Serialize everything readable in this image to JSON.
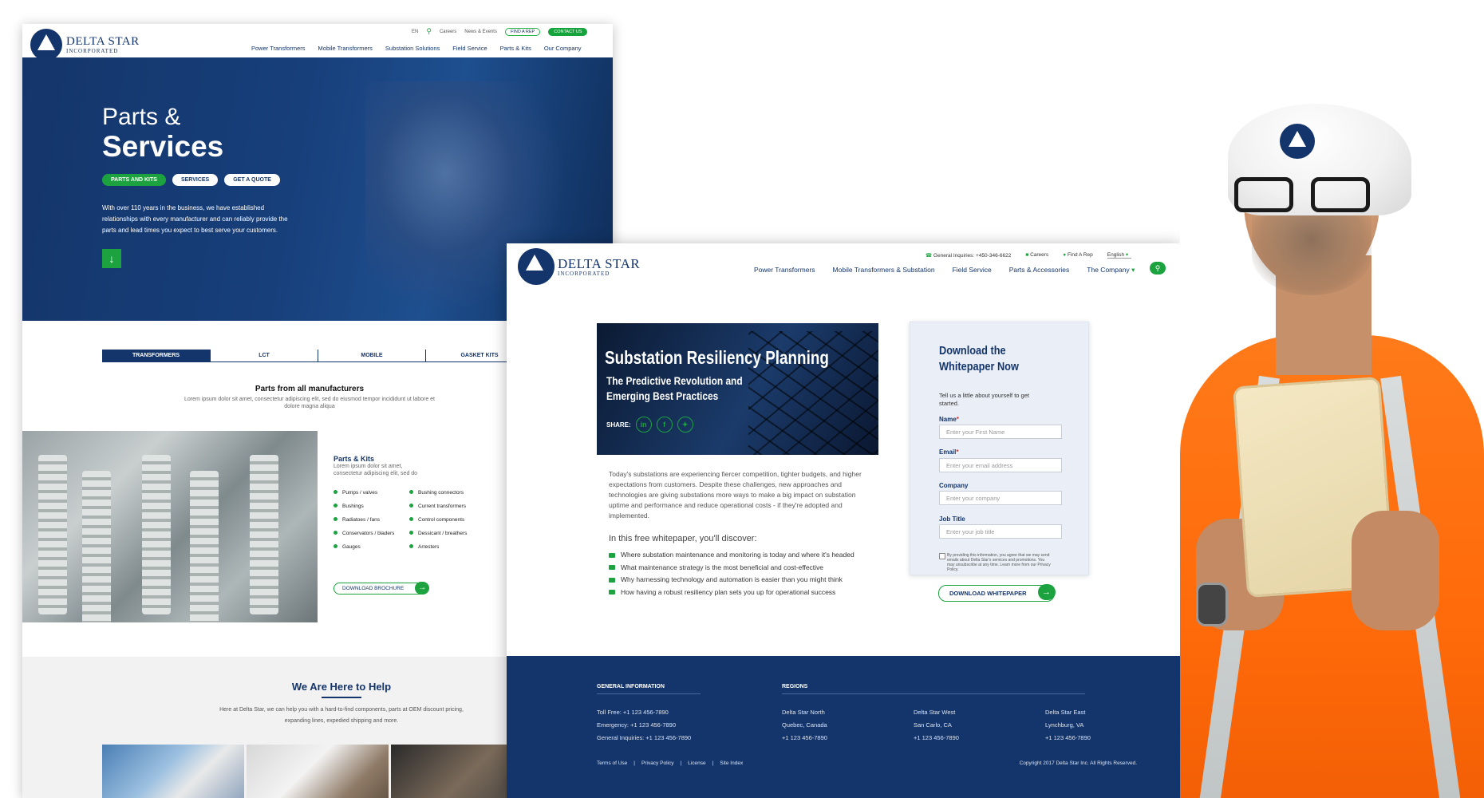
{
  "colors": {
    "navy": "#14356b",
    "green": "#1ca33f",
    "white": "#ffffff",
    "orange": "#ff7a1a"
  },
  "brand": {
    "name": "DELTA STAR",
    "sub": "INCORPORATED",
    "badge": "DELTA STAR INC."
  },
  "pageA": {
    "utility": {
      "lang": "EN",
      "search_icon": "search-icon",
      "careers": "Careers",
      "news": "News & Events",
      "find_rep": "FIND A REP",
      "contact": "CONTACT US"
    },
    "nav": [
      "Power Transformers",
      "Mobile Transformers",
      "Substation Solutions",
      "Field Service",
      "Parts & Kits",
      "Our Company"
    ],
    "hero": {
      "title_line1": "Parts &",
      "title_line2": "Services",
      "buttons": [
        "PARTS AND KITS",
        "SERVICES",
        "GET A QUOTE"
      ],
      "description": "With over 110 years in the business, we have established relationships with every manufacturer and can reliably provide the parts and lead times you expect to best serve your customers."
    },
    "tabs": [
      "TRANSFORMERS",
      "LCT",
      "MOBILE",
      "GASKET KITS"
    ],
    "parts": {
      "title": "Parts from all manufacturers",
      "subtitle": "Lorem ipsum dolor sit amet, consectetur adipiscing elit, sed do eiusmod tempor incididunt ut labore et dolore magna aliqua"
    },
    "kits": {
      "title": "Parts & Kits",
      "subtitle": "Lorem ipsum dolor sit amet, consectetur adipiscing elit, sed do",
      "items": [
        "Pumps / valves",
        "Bushing connectors",
        "Bushings",
        "Current transformers",
        "Radiatoes / fans",
        "Control components",
        "Conservators / bladers",
        "Dessicant / breathers",
        "Gauges",
        "Arresters"
      ],
      "download": "DOWNLOAD BROCHURE"
    },
    "help": {
      "title": "We Are Here to Help",
      "description": "Here at Delta Star, we can help you with a hard-to-find components, parts at OEM discount pricing, expanding lines, expedied shipping and more."
    }
  },
  "pageB": {
    "utility": {
      "phone": "General Inquiries: +450-346-6622",
      "careers": "Careers",
      "find_rep": "Find A Rep",
      "lang": "English"
    },
    "nav": [
      "Power Transformers",
      "Mobile Transformers &  Substation",
      "Field Service",
      "Parts & Accessories",
      "The Company"
    ],
    "banner": {
      "title": "Substation Resiliency Planning",
      "subtitle": "The Predictive Revolution and Emerging Best Practices",
      "share": "SHARE:",
      "share_icons": [
        "linkedin-icon",
        "facebook-icon",
        "twitter-icon"
      ]
    },
    "intro": "Today's substations are experiencing fiercer competition, tighter budgets, and higher expectations from customers. Despite these challenges, new approaches and technologies are giving substations more ways to make a big impact on substation uptime and performance and reduce operational costs - if they're adopted and implemented.",
    "discover": "In this free whitepaper, you'll discover:",
    "points": [
      "Where substation maintenance and monitoring is today and where it's headed",
      "What maintenance strategy is the most beneficial and cost-effective",
      "Why harnessing technology and automation is easier than you might think",
      "How having a robust resiliency plan sets you up for operational success"
    ],
    "form": {
      "title": "Download the Whitepaper Now",
      "intro": "Tell us a little about yourself to get started.",
      "fields": [
        {
          "label": "Name",
          "required": "*",
          "placeholder": "Enter your First Name"
        },
        {
          "label": "Email",
          "required": "*",
          "placeholder": "Enter your email address"
        },
        {
          "label": "Company",
          "required": "",
          "placeholder": "Enter your company"
        },
        {
          "label": "Job Title",
          "required": "",
          "placeholder": "Enter your job title"
        }
      ],
      "consent": "By providing this information, you agree that we may send emails about Delta Star's services and promotions. You may unsubscribe at any time. Learn more from our Privacy Policy.",
      "submit": "DOWNLOAD WHITEPAPER"
    },
    "footer": {
      "general_heading": "GENERAL INFORMATION",
      "general": [
        "Toll Free: +1 123 456-7890",
        "Emergency: +1 123 456-7890",
        "General Inquiries: +1 123 456-7890"
      ],
      "regions_heading": "REGIONS",
      "regions": [
        {
          "name": "Delta Star North",
          "city": "Quebec, Canada",
          "phone": "+1 123 456-7890"
        },
        {
          "name": "Delta Star West",
          "city": "San Carlo, CA",
          "phone": "+1 123 456-7890"
        },
        {
          "name": "Delta Star East",
          "city": "Lynchburg, VA",
          "phone": "+1 123 456-7890"
        }
      ],
      "links": [
        "Terms of Use",
        "|",
        "Privacy Policy",
        "|",
        "License",
        "|",
        "Site Index"
      ],
      "copyright": "Copyright 2017 Delta Star Inc. All Rights Reserved."
    }
  }
}
